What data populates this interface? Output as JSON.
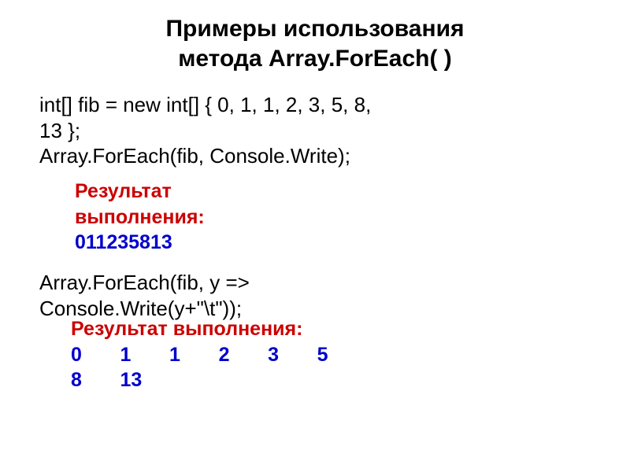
{
  "title_line1": "Примеры использования",
  "title_line2": "метода Array.ForEach( )",
  "code1_line1": "int[] fib = new int[] { 0, 1, 1, 2, 3, 5, 8,",
  "code1_line2": "13 };",
  "code1_line3": "Array.ForEach(fib, Console.Write);",
  "result1_label_line1": "Результат",
  "result1_label_line2": "выполнения:",
  "result1_output": "011235813",
  "code2_line1": "Array.ForEach(fib, y =>",
  "code2_line2": "Console.Write(y+\"\\t\"));",
  "result2_label": "Результат выполнения:",
  "result2_output_line1": "0       1       1       2       3       5",
  "result2_output_line2": "8       13"
}
